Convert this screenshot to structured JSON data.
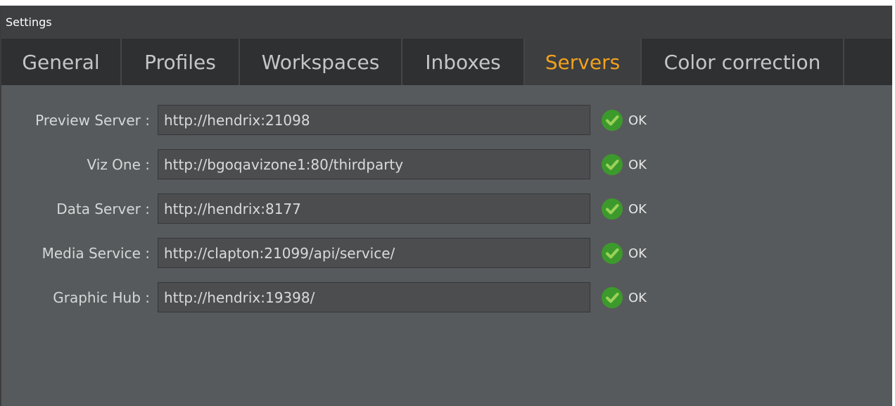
{
  "window": {
    "title": "Settings"
  },
  "tabs": [
    {
      "label": "General",
      "active": false
    },
    {
      "label": "Profiles",
      "active": false
    },
    {
      "label": "Workspaces",
      "active": false
    },
    {
      "label": "Inboxes",
      "active": false
    },
    {
      "label": "Servers",
      "active": true
    },
    {
      "label": "Color correction",
      "active": false
    }
  ],
  "servers": [
    {
      "label": "Preview Server :",
      "value": "http://hendrix:21098",
      "status": "OK",
      "status_icon": "check-circle-icon"
    },
    {
      "label": "Viz One :",
      "value": "http://bgoqavizone1:80/thirdparty",
      "status": "OK",
      "status_icon": "check-circle-icon"
    },
    {
      "label": "Data Server :",
      "value": "http://hendrix:8177",
      "status": "OK",
      "status_icon": "check-circle-icon"
    },
    {
      "label": "Media Service :",
      "value": "http://clapton:21099/api/service/",
      "status": "OK",
      "status_icon": "check-circle-icon"
    },
    {
      "label": "Graphic Hub :",
      "value": "http://hendrix:19398/",
      "status": "OK",
      "status_icon": "check-circle-icon"
    }
  ],
  "colors": {
    "accent": "#f1a11c",
    "ok_green": "#3c9a2c"
  }
}
